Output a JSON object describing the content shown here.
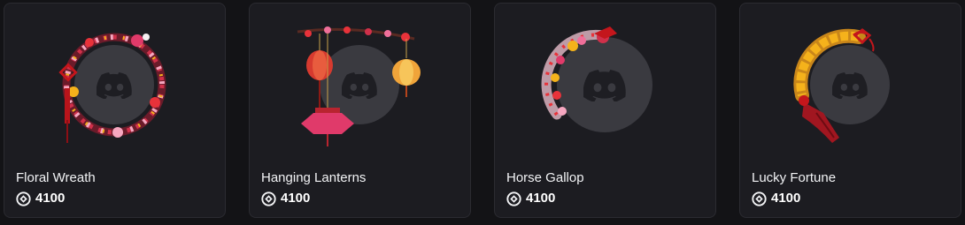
{
  "shop": {
    "items": [
      {
        "name": "Floral Wreath",
        "price": "4100",
        "decoration": "floral-wreath"
      },
      {
        "name": "Hanging Lanterns",
        "price": "4100",
        "decoration": "hanging-lanterns"
      },
      {
        "name": "Horse Gallop",
        "price": "4100",
        "decoration": "horse-gallop"
      },
      {
        "name": "Lucky Fortune",
        "price": "4100",
        "decoration": "lucky-fortune"
      }
    ],
    "currency_icon": "orb-icon",
    "avatar_icon": "discord-logo-icon"
  },
  "colors": {
    "page_bg": "#131316",
    "card_bg": "#1c1c21",
    "avatar_bg": "#3a3a40",
    "logo": "#1e1e23",
    "text": "#f2f3f5",
    "accent_red": "#c4161c",
    "accent_pink": "#f06f9a",
    "accent_gold": "#f5b21b"
  }
}
